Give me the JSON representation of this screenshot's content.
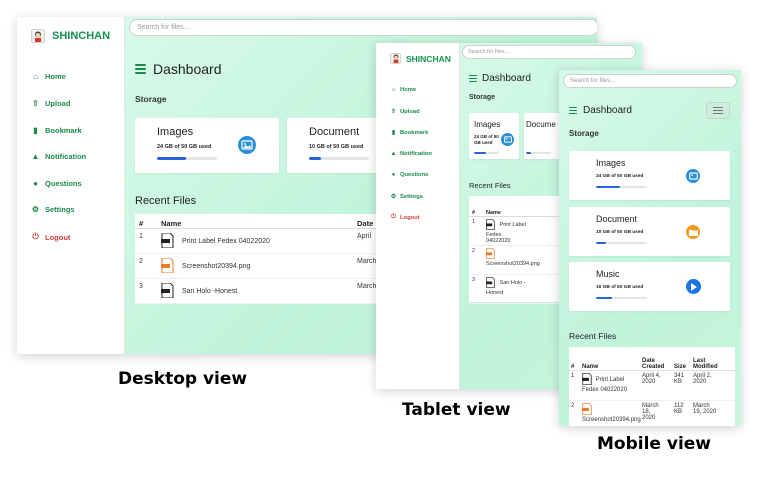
{
  "app": {
    "brand": "SHINCHAN",
    "search_placeholder": "Search for files...",
    "dashboard_title": "Dashboard",
    "storage_label": "Storage",
    "recent_title": "Recent Files"
  },
  "nav": [
    {
      "label": "Home",
      "icon": "home-icon"
    },
    {
      "label": "Upload",
      "icon": "upload-icon"
    },
    {
      "label": "Bookmark",
      "icon": "bookmark-icon"
    },
    {
      "label": "Notification",
      "icon": "bell-icon"
    },
    {
      "label": "Questions",
      "icon": "question-icon"
    },
    {
      "label": "Settings",
      "icon": "gear-icon"
    },
    {
      "label": "Logout",
      "icon": "power-icon"
    }
  ],
  "storage": [
    {
      "name": "Images",
      "usage": "24 GB of 50 GB used",
      "fill": 0.48,
      "icon": "images-icon",
      "color": "#2b8fd6"
    },
    {
      "name": "Document",
      "usage": "10 GB of 50 GB used",
      "fill": 0.2,
      "icon": "folder-icon",
      "color": "#f39a1e"
    },
    {
      "name": "Music",
      "usage": "16 GB of 50 GB used",
      "fill": 0.32,
      "icon": "play-icon",
      "color": "#1a73e8"
    }
  ],
  "table": {
    "headers": {
      "num": "#",
      "name": "Name",
      "date": "Date",
      "date_created": "Date Created",
      "size": "Size",
      "last_modified": "Last Modified"
    },
    "rows": [
      {
        "num": "1",
        "name": "Print Label Fedex 04022020",
        "date_short": "April",
        "date_created": "April 4, 2020",
        "size": "341 KB",
        "modified": "April 2, 2020",
        "icon": "pdf-file-icon"
      },
      {
        "num": "2",
        "name": "Screenshot20394.png",
        "date_short": "March",
        "date_created": "March 18, 2020",
        "size": "112 KB",
        "modified": "March 19, 2020",
        "icon": "image-file-icon"
      },
      {
        "num": "3",
        "name": "San Holo -Honest",
        "date_short": "March",
        "date_created": "",
        "size": "",
        "modified": "",
        "icon": "mp3-file-icon"
      }
    ]
  },
  "tablet_cards": {
    "images_name": "Images",
    "images_usage": "24 GB of 50 GB used",
    "doc_name": "Docume"
  },
  "tablet_row_names": {
    "row1_a": "Print Label Fedex",
    "row1_b": "04022020",
    "row2": "Screenshot20394.png",
    "row3_a": "San Holo -",
    "row3_b": "Honest"
  },
  "mobile_row_names": {
    "row1_a": "Print Label",
    "row1_b": "Fedex 04022020",
    "row2": "Screenshot20394.png",
    "date1_a": "April 4,",
    "date1_b": "2020",
    "size1_a": "341",
    "size1_b": "KB",
    "mod1_a": "April 2,",
    "mod1_b": "2020",
    "date2_a": "March",
    "date2_b": "18,",
    "date2_c": "2020",
    "size2_a": "112",
    "size2_b": "KB",
    "mod2_a": "March",
    "mod2_b": "19, 2020",
    "created_a": "Date",
    "created_b": "Created",
    "last_a": "Last",
    "last_b": "Modified"
  },
  "captions": {
    "desktop": "Desktop view",
    "tablet": "Tablet view",
    "mobile": "Mobile view"
  },
  "colors": {
    "accent": "#1c8a4a",
    "logout": "#d23a3a",
    "progress": "#2962d9",
    "main_bg": "#c8f6df"
  }
}
